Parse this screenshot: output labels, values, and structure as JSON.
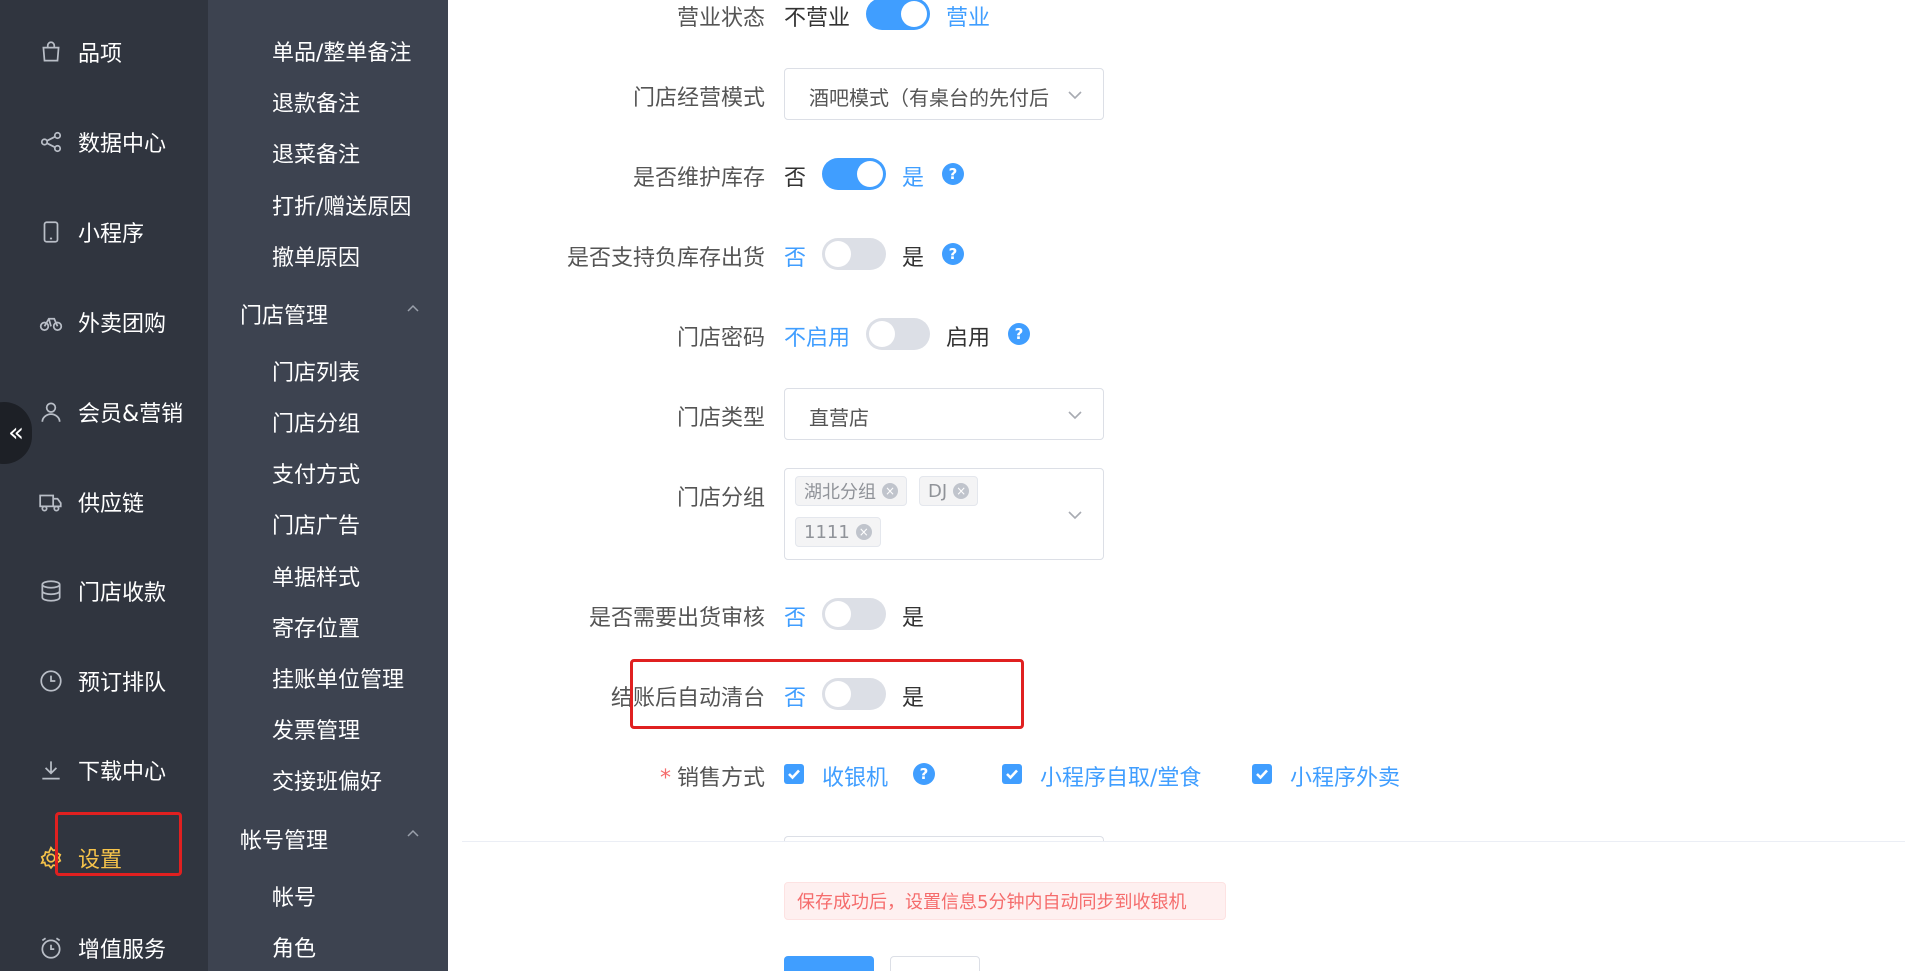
{
  "sidebar": {
    "items": [
      {
        "label": "品项",
        "icon": "bag-icon"
      },
      {
        "label": "数据中心",
        "icon": "share-icon"
      },
      {
        "label": "小程序",
        "icon": "phone-icon"
      },
      {
        "label": "外卖团购",
        "icon": "bike-icon"
      },
      {
        "label": "会员&营销",
        "icon": "user-icon"
      },
      {
        "label": "供应链",
        "icon": "truck-icon"
      },
      {
        "label": "门店收款",
        "icon": "coins-icon"
      },
      {
        "label": "预订排队",
        "icon": "clock-icon"
      },
      {
        "label": "下载中心",
        "icon": "download-icon"
      },
      {
        "label": "设置",
        "icon": "gear-icon",
        "active": true
      },
      {
        "label": "增值服务",
        "icon": "alarm-icon"
      }
    ],
    "collapse_glyph": "«"
  },
  "subsidebar": {
    "top_items": [
      "单品/整单备注",
      "退款备注",
      "退菜备注",
      "打折/赠送原因",
      "撤单原因"
    ],
    "groups": [
      {
        "title": "门店管理",
        "items": [
          "门店列表",
          "门店分组",
          "支付方式",
          "门店广告",
          "单据样式",
          "寄存位置",
          "挂账单位管理",
          "发票管理",
          "交接班偏好"
        ]
      },
      {
        "title": "帐号管理",
        "items": [
          "帐号",
          "角色"
        ]
      }
    ]
  },
  "form": {
    "business_status": {
      "label": "营业状态",
      "off_text": "不营业",
      "on_text": "营业",
      "on": true
    },
    "mode": {
      "label": "门店经营模式",
      "value": "酒吧模式（有桌台的先付后"
    },
    "maintain_stock": {
      "label": "是否维护库存",
      "off_text": "否",
      "on_text": "是",
      "on": true
    },
    "negative_stock": {
      "label": "是否支持负库存出货",
      "off_text": "否",
      "on_text": "是",
      "on": false
    },
    "store_password": {
      "label": "门店密码",
      "off_text": "不启用",
      "on_text": "启用",
      "on": false
    },
    "store_type": {
      "label": "门店类型",
      "value": "直营店"
    },
    "store_group": {
      "label": "门店分组",
      "tags": [
        "湖北分组",
        "DJ",
        "1111"
      ]
    },
    "shipment_review": {
      "label": "是否需要出货审核",
      "off_text": "否",
      "on_text": "是",
      "on": false
    },
    "auto_clear": {
      "label": "结账后自动清台",
      "off_text": "否",
      "on_text": "是",
      "on": false
    },
    "sales_method": {
      "label": "销售方式",
      "required_mark": "*",
      "options": [
        "收银机",
        "小程序自取/堂食",
        "小程序外卖"
      ]
    },
    "help_glyph": "?",
    "tag_close_glyph": "×"
  },
  "footer": {
    "notice": "保存成功后，设置信息5分钟内自动同步到收银机"
  },
  "colors": {
    "accent": "#409eff",
    "sidebar_bg": "#30353f",
    "subsidebar_bg": "#3d4350",
    "active": "#f6c34a",
    "highlight": "#e02020"
  }
}
